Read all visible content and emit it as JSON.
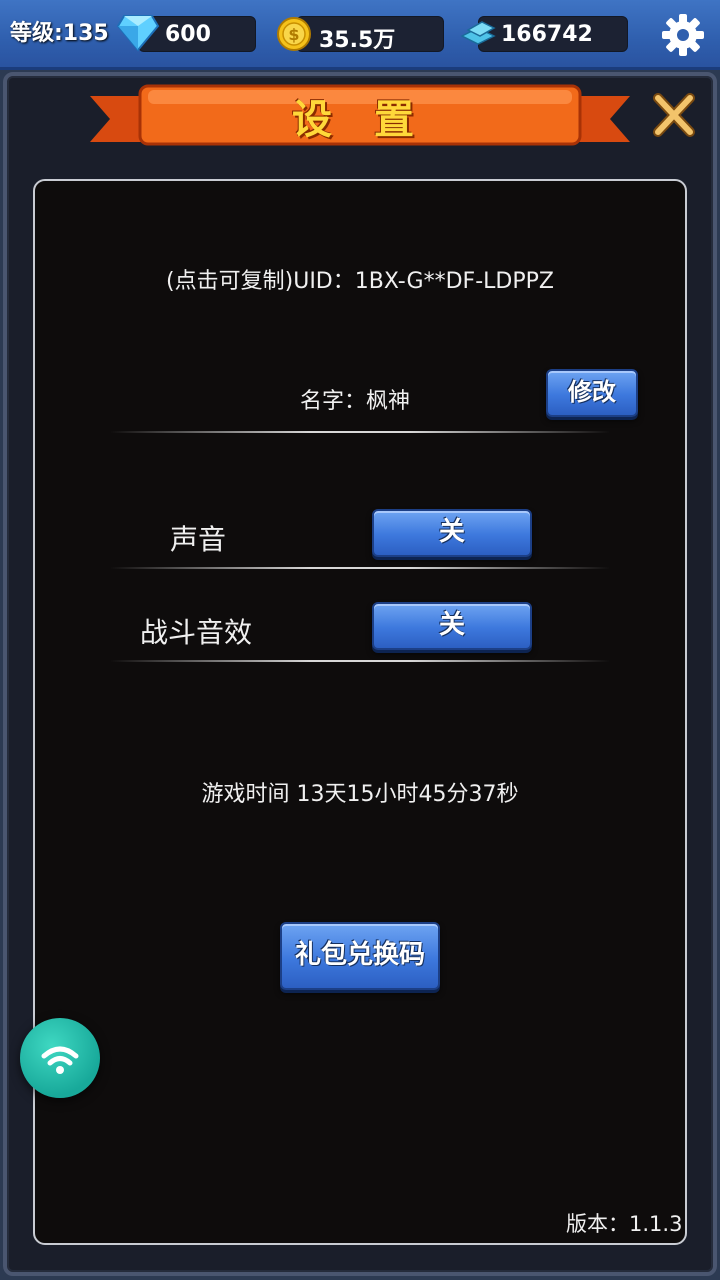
{
  "topbar": {
    "level_text": "等级:135",
    "diamonds": "600",
    "gold": "35.5万",
    "crystals": "166742"
  },
  "settings": {
    "title": "设 置",
    "uid_text": "(点击可复制)UID：1BX-G**DF-LDPPZ",
    "name_text": "名字：枫神",
    "edit_button": "修改",
    "sound_label": "声音",
    "sound_button": "关",
    "battle_sfx_label": "战斗音效",
    "battle_sfx_button": "关",
    "playtime_text": "游戏时间 13天15小时45分37秒",
    "gift_code_button": "礼包兑换码",
    "version_text": "版本：1.1.3"
  },
  "colors": {
    "title_yellow": "#ffd83a",
    "ribbon_orange": "#f06a1c",
    "button_blue": "#3d78dd",
    "wifi_teal": "#18a99a"
  }
}
